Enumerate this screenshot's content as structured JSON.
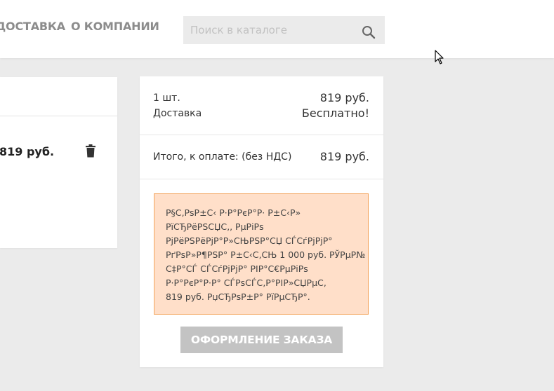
{
  "header": {
    "nav": {
      "delivery": "ДОСТАВКА",
      "company": "О КОМПАНИИ"
    },
    "search": {
      "placeholder": "Поиск в каталоге",
      "icon": "search-icon"
    }
  },
  "cart_item": {
    "price": "819 руб.",
    "delete_icon": "trash-icon"
  },
  "summary": {
    "quantity_label": "1 шт.",
    "quantity_value": "819 руб.",
    "delivery_label": "Доставка",
    "delivery_value": "Бесплатно!",
    "total_label": "Итого, к оплате: (без НДС)",
    "total_value": "819 руб.",
    "notice_lines": [
      "Р§С‚РѕР±С‹ Р·Р°РєР°Р· Р±С‹Р»",
      "РїСЂРёРЅСЏС‚, РµРіРѕ",
      "РјРёРЅРёРјР°Р»СЊРЅР°СЏ СЃСѓРјРјР°",
      "РґРѕР»Р¶РЅР° Р±С‹С‚СЊ 1 000 руб. РЎРµР№",
      "С‡Р°СЃ СЃСѓРјРјР° РІР°С€РµРіРѕ",
      "Р·Р°РєР°Р·Р° СЃРѕСЃС‚Р°РІР»СЏРµС‚",
      "819 руб. РџСЂРѕР±Р° РїРµСЂР°."
    ],
    "order_button": "ОФОРМЛЕНИЕ ЗАКАЗА"
  },
  "colors": {
    "page_background": "#ebebeb",
    "notice_background": "#ffdfc9",
    "notice_border": "#f3a45c",
    "button_disabled": "#c3c3c3",
    "nav_text": "#8c8c8c"
  }
}
